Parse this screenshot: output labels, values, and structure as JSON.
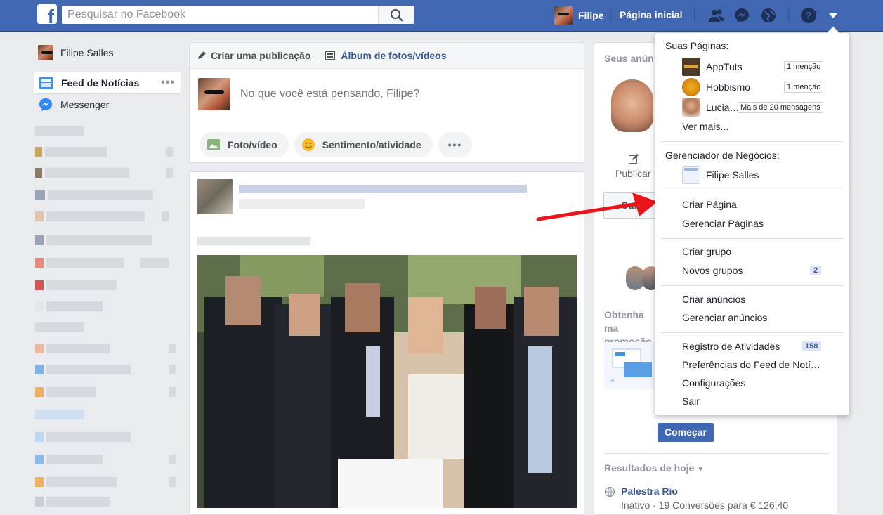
{
  "topbar": {
    "search_placeholder": "Pesquisar no Facebook",
    "user_name": "Filipe",
    "home_label": "Página inicial",
    "brand_color": "#4267b2"
  },
  "left": {
    "profile_name": "Filipe Salles",
    "items": [
      {
        "label": "Feed de Notícias",
        "icon": "news-feed-icon"
      },
      {
        "label": "Messenger",
        "icon": "messenger-icon"
      }
    ]
  },
  "composer": {
    "create_post": "Criar uma publicação",
    "album": "Álbum de fotos/vídeos",
    "placeholder": "No que você está pensando, Filipe?",
    "photo_video": "Foto/vídeo",
    "feeling": "Sentimento/atividade",
    "more": "•••"
  },
  "right": {
    "title": "Seus anún",
    "publish": "Publicar",
    "liked": "Curtid",
    "obtain": "Obtenha ma promoção c",
    "start": "Começar",
    "results_today": "Resultados de hoje",
    "campaign_name": "Palestra Rio",
    "campaign_status": "Inativo · 19 Conversões para € 126,40"
  },
  "dropdown": {
    "your_pages": "Suas Páginas:",
    "pages": [
      {
        "name": "AppTuts",
        "badge": "1 menção"
      },
      {
        "name": "Hobbismo",
        "badge": "1 menção"
      },
      {
        "name": "Lucia…",
        "badge": "Mais de 20 mensagens"
      }
    ],
    "see_more": "Ver mais...",
    "business_manager": "Gerenciador de Negócios:",
    "business_account": "Filipe Salles",
    "create_page": "Criar Página",
    "manage_pages": "Gerenciar Páginas",
    "create_group": "Criar grupo",
    "new_groups": "Novos grupos",
    "new_groups_count": "2",
    "create_ads": "Criar anúncios",
    "manage_ads": "Gerenciar anúncios",
    "activity_log": "Registro de Atividades",
    "activity_count": "158",
    "feed_prefs": "Preferências do Feed de Notí…",
    "settings": "Configurações",
    "logout": "Sair"
  }
}
